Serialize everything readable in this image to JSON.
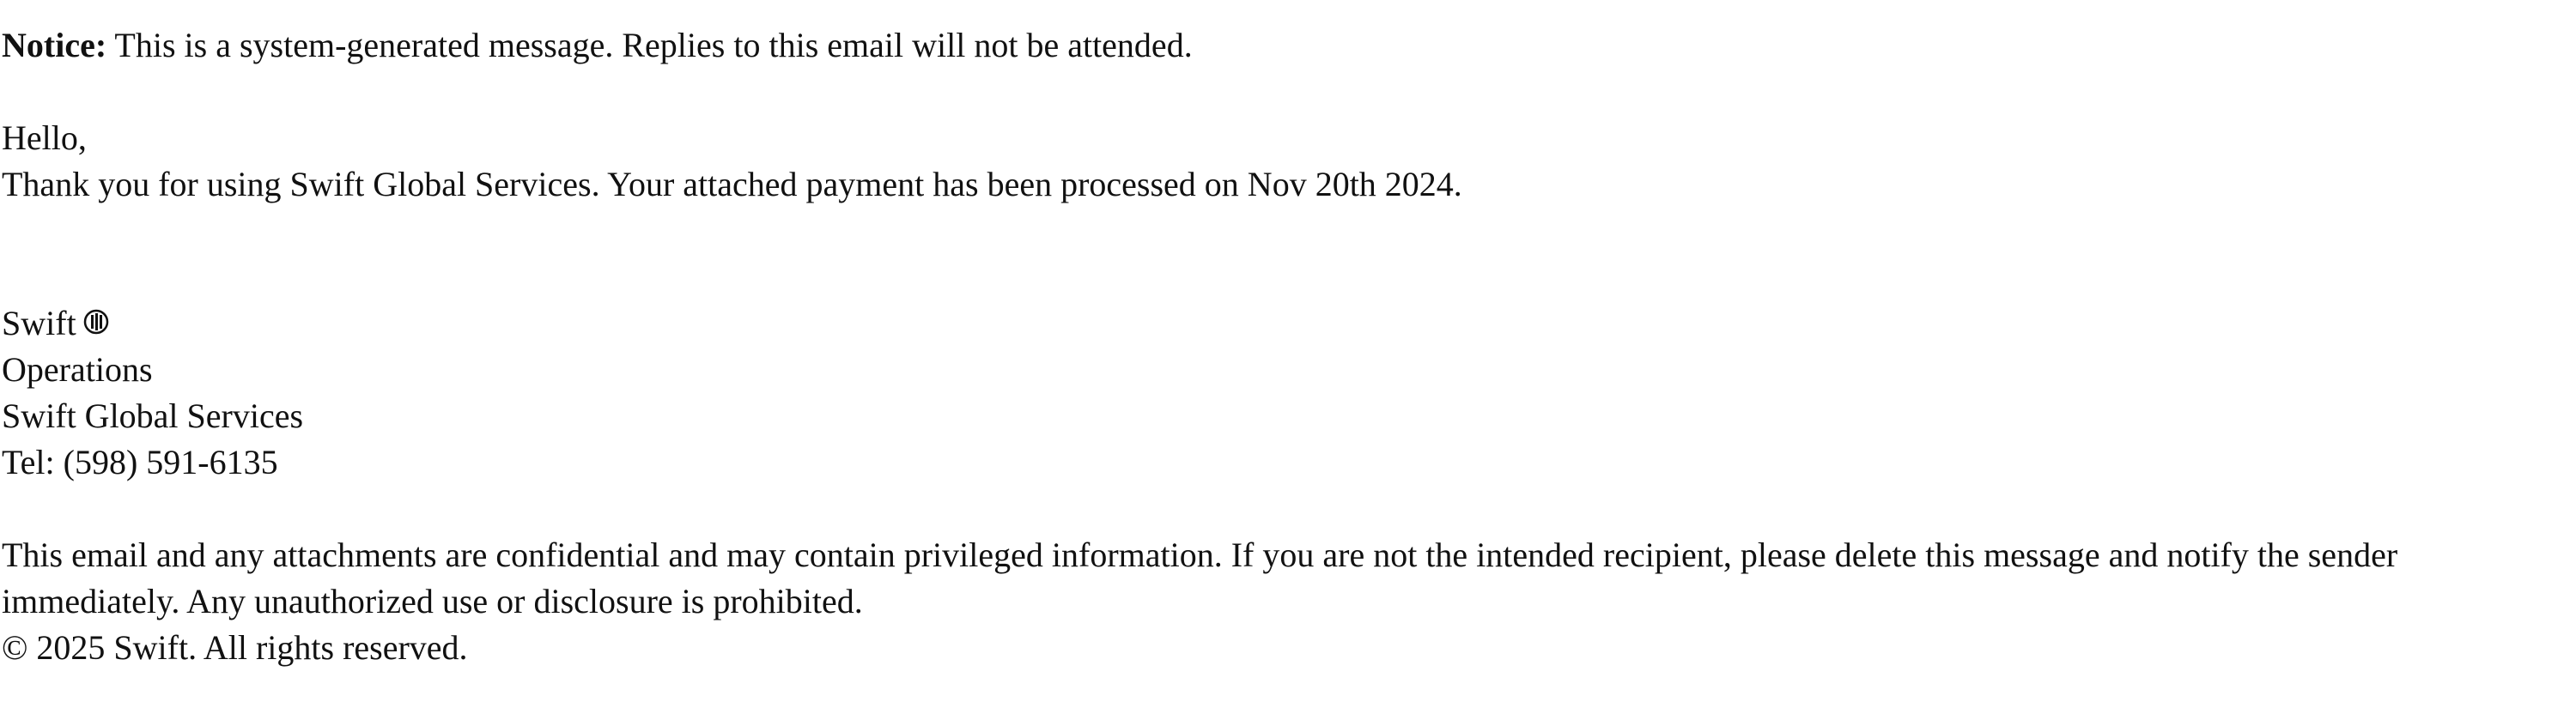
{
  "email": {
    "notice": {
      "label": "Notice:",
      "text": " This is a system-generated message. Replies to this email will not be attended."
    },
    "greeting": "Hello,",
    "message": "Thank you for using Swift Global Services. Your attached payment has been processed on Nov 20th 2024.",
    "signature": {
      "name": "Swift",
      "logo_icon": "swift-logo-icon",
      "department": "Operations",
      "company": "Swift Global Services",
      "phone": "Tel: (598) 591-6135"
    },
    "disclaimer": "This email and any attachments are confidential and may contain privileged information. If you are not the intended recipient, please delete this message and notify the sender immediately. Any unauthorized use or disclosure is prohibited.",
    "copyright": "© 2025 Swift. All rights reserved."
  }
}
